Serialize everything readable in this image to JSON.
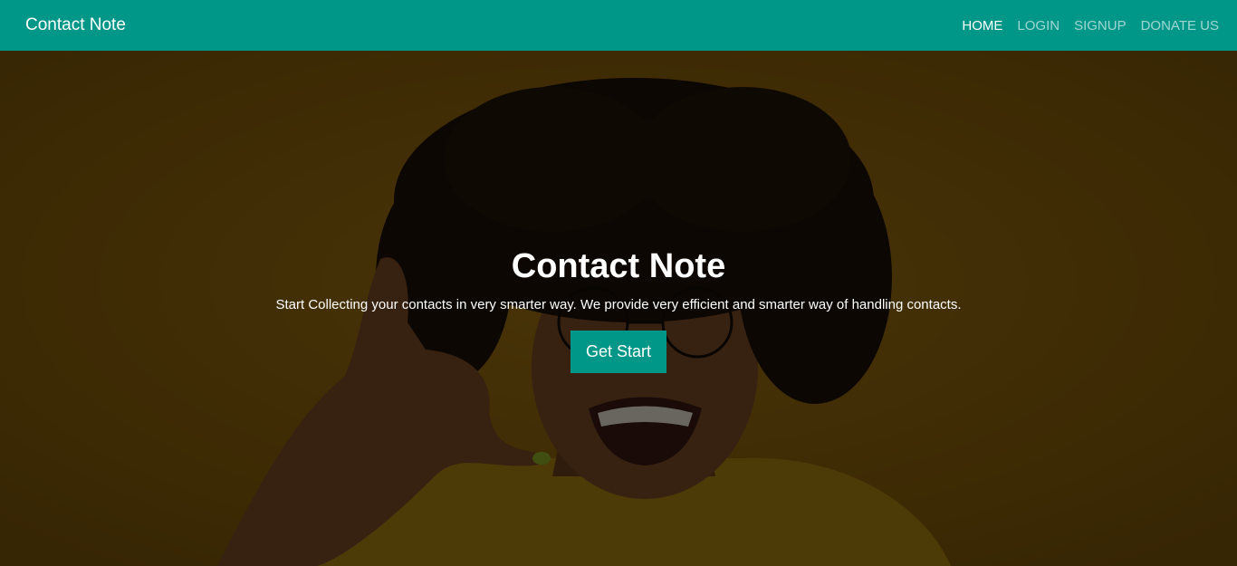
{
  "navbar": {
    "brand": "Contact Note",
    "links": [
      {
        "label": "HOME",
        "active": true
      },
      {
        "label": "LOGIN"
      },
      {
        "label": "SIGNUP"
      },
      {
        "label": "DONATE US"
      }
    ],
    "color": "#009688"
  },
  "hero": {
    "title": "Contact Note",
    "subtitle": "Start Collecting your contacts in very smarter way. We provide very efficient and smarter way of handling contacts.",
    "cta_label": "Get Start",
    "accent": "#009688"
  }
}
